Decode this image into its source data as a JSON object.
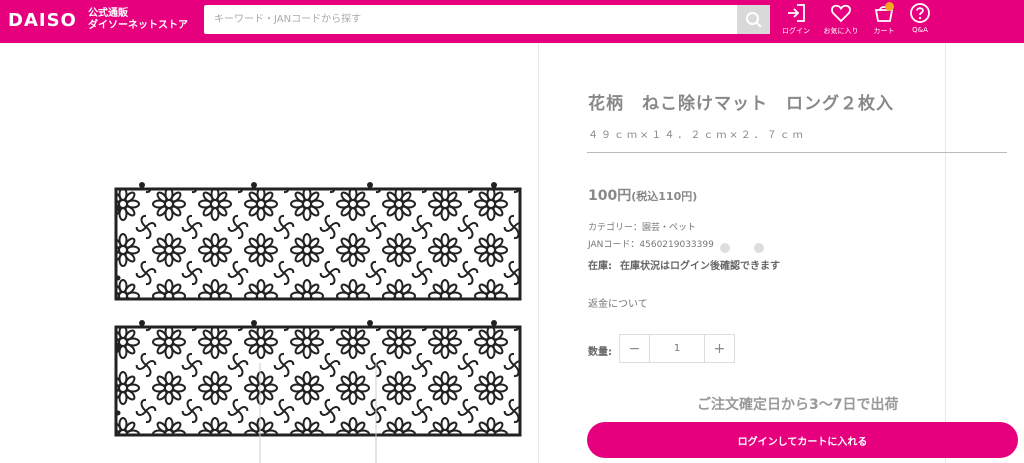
{
  "header": {
    "logo": "DAISO",
    "logo_sub_line1": "公式通販",
    "logo_sub_line2": "ダイソーネットストア",
    "search_placeholder": "キーワード・JANコードから探す",
    "icons": [
      {
        "name": "login-icon",
        "label": "ログイン"
      },
      {
        "name": "heart-icon",
        "label": "お気に入り"
      },
      {
        "name": "cart-icon",
        "label": "カート"
      },
      {
        "name": "help-icon",
        "label": "Q&A"
      }
    ],
    "brand_color": "#e6007e"
  },
  "product": {
    "title": "花柄　ねこ除けマット　ロング２枚入",
    "size": "４９ｃｍ×１４．２ｃｍ×２．７ｃｍ",
    "price": "100円",
    "price_tax": "(税込110円)",
    "category": "カテゴリー：園芸・ペット",
    "jan": "JANコード：4560219033399",
    "stock_label": "在庫:",
    "stock_value": "在庫状況はログイン後確認できます",
    "return_link": "返金について",
    "qty_label": "数量:",
    "qty_minus": "−",
    "qty_value": "1",
    "qty_plus": "+",
    "shipping": "ご注文確定日から3〜7日で出荷",
    "cart_button": "ログインしてカートに入れる"
  }
}
